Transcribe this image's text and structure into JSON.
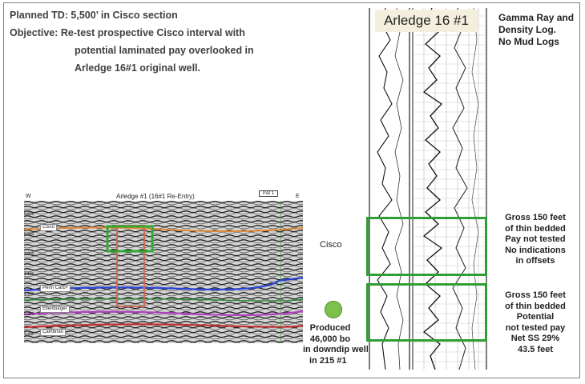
{
  "header": {
    "line1": "Planned TD: 5,500’ in Cisco section",
    "line2": "Objective:  Re-test prospective Cisco interval with",
    "line3": "potential laminated pay overlooked in",
    "line4": "Arledge 16#1 original well."
  },
  "seismic": {
    "title": "Arledge #1 (16#1 Re-Entry)",
    "left_label": "W",
    "right_label": "E",
    "badge": "Pat 1",
    "horizons": [
      "Cisco",
      "Penn Carb+",
      "Ellenburger",
      "Cambrian"
    ],
    "time_labels": [
      "0.800",
      "0.900",
      "1.000",
      "1.100",
      "1.200",
      "1.300",
      "1.400"
    ]
  },
  "cisco_label": "Cisco",
  "produced_note": {
    "l1": "Produced",
    "l2": "46,000 bo",
    "l3": "in downdip well",
    "l4": "in 215 #1"
  },
  "log": {
    "title": "Arledge 16 #1"
  },
  "log_note": {
    "l1": "Gamma Ray and",
    "l2": "Density Log.",
    "l3": "No Mud Logs"
  },
  "zone1_note": {
    "l1": "Gross 150 feet",
    "l2": "of thin bedded",
    "l3": "Pay not tested",
    "l4": "No indications",
    "l5": "in offsets"
  },
  "zone2_note": {
    "l1": "Gross 150 feet",
    "l2": "of thin bedded",
    "l3": "Potential",
    "l4": "not tested pay",
    "l5": "Net SS 29%",
    "l6": "43.5 feet"
  },
  "colors": {
    "box_green": "#2f9e34",
    "well_green": "#7cc24a",
    "horizon_cisco": "#e08a3a",
    "horizon_penn": "#2b44d6",
    "horizon_ellen": "#b040c0",
    "horizon_cambrian": "#c03030"
  }
}
